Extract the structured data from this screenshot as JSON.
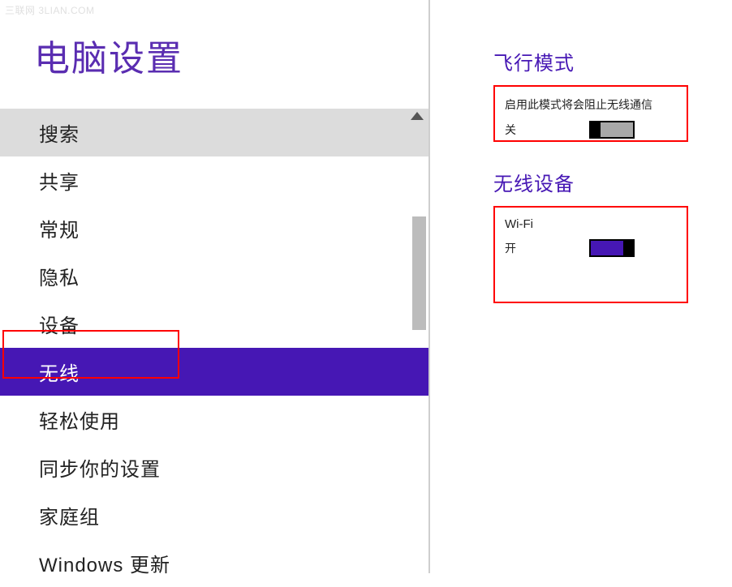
{
  "watermark": "三联网 3LIAN.COM",
  "page_title": "电脑设置",
  "nav": {
    "items": [
      {
        "label": "搜索",
        "state": "hovered"
      },
      {
        "label": "共享",
        "state": ""
      },
      {
        "label": "常规",
        "state": ""
      },
      {
        "label": "隐私",
        "state": ""
      },
      {
        "label": "设备",
        "state": ""
      },
      {
        "label": "无线",
        "state": "selected"
      },
      {
        "label": "轻松使用",
        "state": ""
      },
      {
        "label": "同步你的设置",
        "state": ""
      },
      {
        "label": "家庭组",
        "state": ""
      },
      {
        "label": "Windows 更新",
        "state": ""
      }
    ]
  },
  "content": {
    "airplane": {
      "title": "飞行模式",
      "description": "启用此模式将会阻止无线通信",
      "state_label": "关",
      "state": "off"
    },
    "wireless": {
      "title": "无线设备",
      "wifi_label": "Wi-Fi",
      "state_label": "开",
      "state": "on"
    }
  },
  "colors": {
    "accent": "#4617b4",
    "highlight": "#ff0000"
  }
}
